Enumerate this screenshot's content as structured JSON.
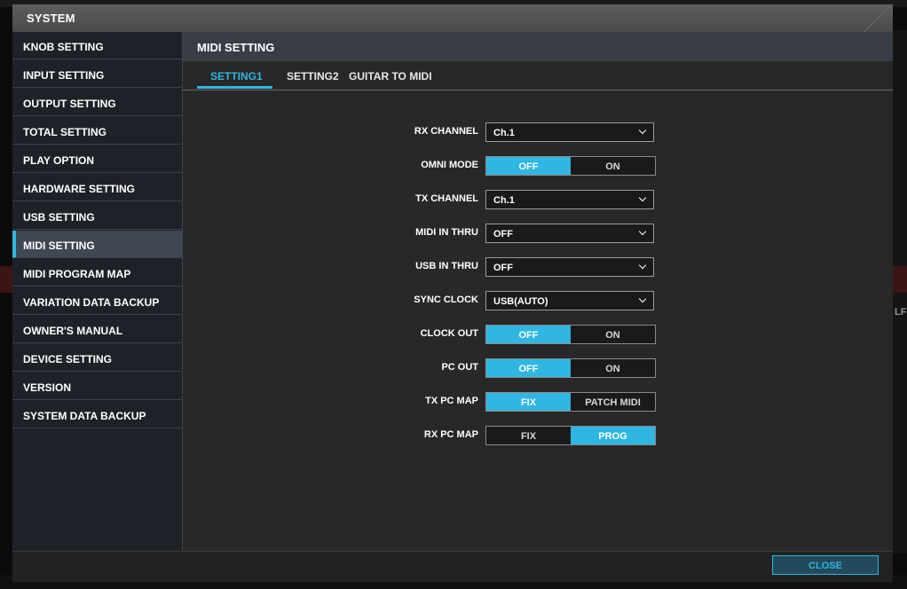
{
  "window": {
    "title": "SYSTEM"
  },
  "sidebar": {
    "items": [
      {
        "label": "KNOB SETTING"
      },
      {
        "label": "INPUT SETTING"
      },
      {
        "label": "OUTPUT SETTING"
      },
      {
        "label": "TOTAL SETTING"
      },
      {
        "label": "PLAY OPTION"
      },
      {
        "label": "HARDWARE SETTING"
      },
      {
        "label": "USB SETTING"
      },
      {
        "label": "MIDI SETTING",
        "active": true
      },
      {
        "label": "MIDI PROGRAM MAP"
      },
      {
        "label": "VARIATION DATA BACKUP"
      },
      {
        "label": "OWNER'S MANUAL"
      },
      {
        "label": "DEVICE SETTING"
      },
      {
        "label": "VERSION"
      },
      {
        "label": "SYSTEM DATA BACKUP"
      }
    ]
  },
  "main": {
    "header": "MIDI SETTING",
    "tabs": [
      {
        "label": "SETTING1",
        "active": true
      },
      {
        "label": "SETTING2"
      },
      {
        "label": "GUITAR TO MIDI"
      }
    ],
    "settings": [
      {
        "label": "RX CHANNEL",
        "type": "select",
        "value": "Ch.1"
      },
      {
        "label": "OMNI MODE",
        "type": "toggle",
        "options": [
          "OFF",
          "ON"
        ],
        "selected": "OFF"
      },
      {
        "label": "TX CHANNEL",
        "type": "select",
        "value": "Ch.1"
      },
      {
        "label": "MIDI IN THRU",
        "type": "select",
        "value": "OFF"
      },
      {
        "label": "USB IN THRU",
        "type": "select",
        "value": "OFF"
      },
      {
        "label": "SYNC CLOCK",
        "type": "select",
        "value": "USB(AUTO)"
      },
      {
        "label": "CLOCK OUT",
        "type": "toggle",
        "options": [
          "OFF",
          "ON"
        ],
        "selected": "OFF"
      },
      {
        "label": "PC OUT",
        "type": "toggle",
        "options": [
          "OFF",
          "ON"
        ],
        "selected": "OFF"
      },
      {
        "label": "TX PC MAP",
        "type": "toggle",
        "options": [
          "FIX",
          "PATCH MIDI"
        ],
        "selected": "FIX"
      },
      {
        "label": "RX PC MAP",
        "type": "toggle",
        "options": [
          "FIX",
          "PROG"
        ],
        "selected": "PROG"
      }
    ]
  },
  "footer": {
    "close_label": "CLOSE"
  },
  "background": {
    "edge_text": "LF"
  },
  "colors": {
    "accent": "#2fb6e3",
    "panel": "#282828",
    "sidebar": "#1e2228",
    "header": "#383d46"
  }
}
